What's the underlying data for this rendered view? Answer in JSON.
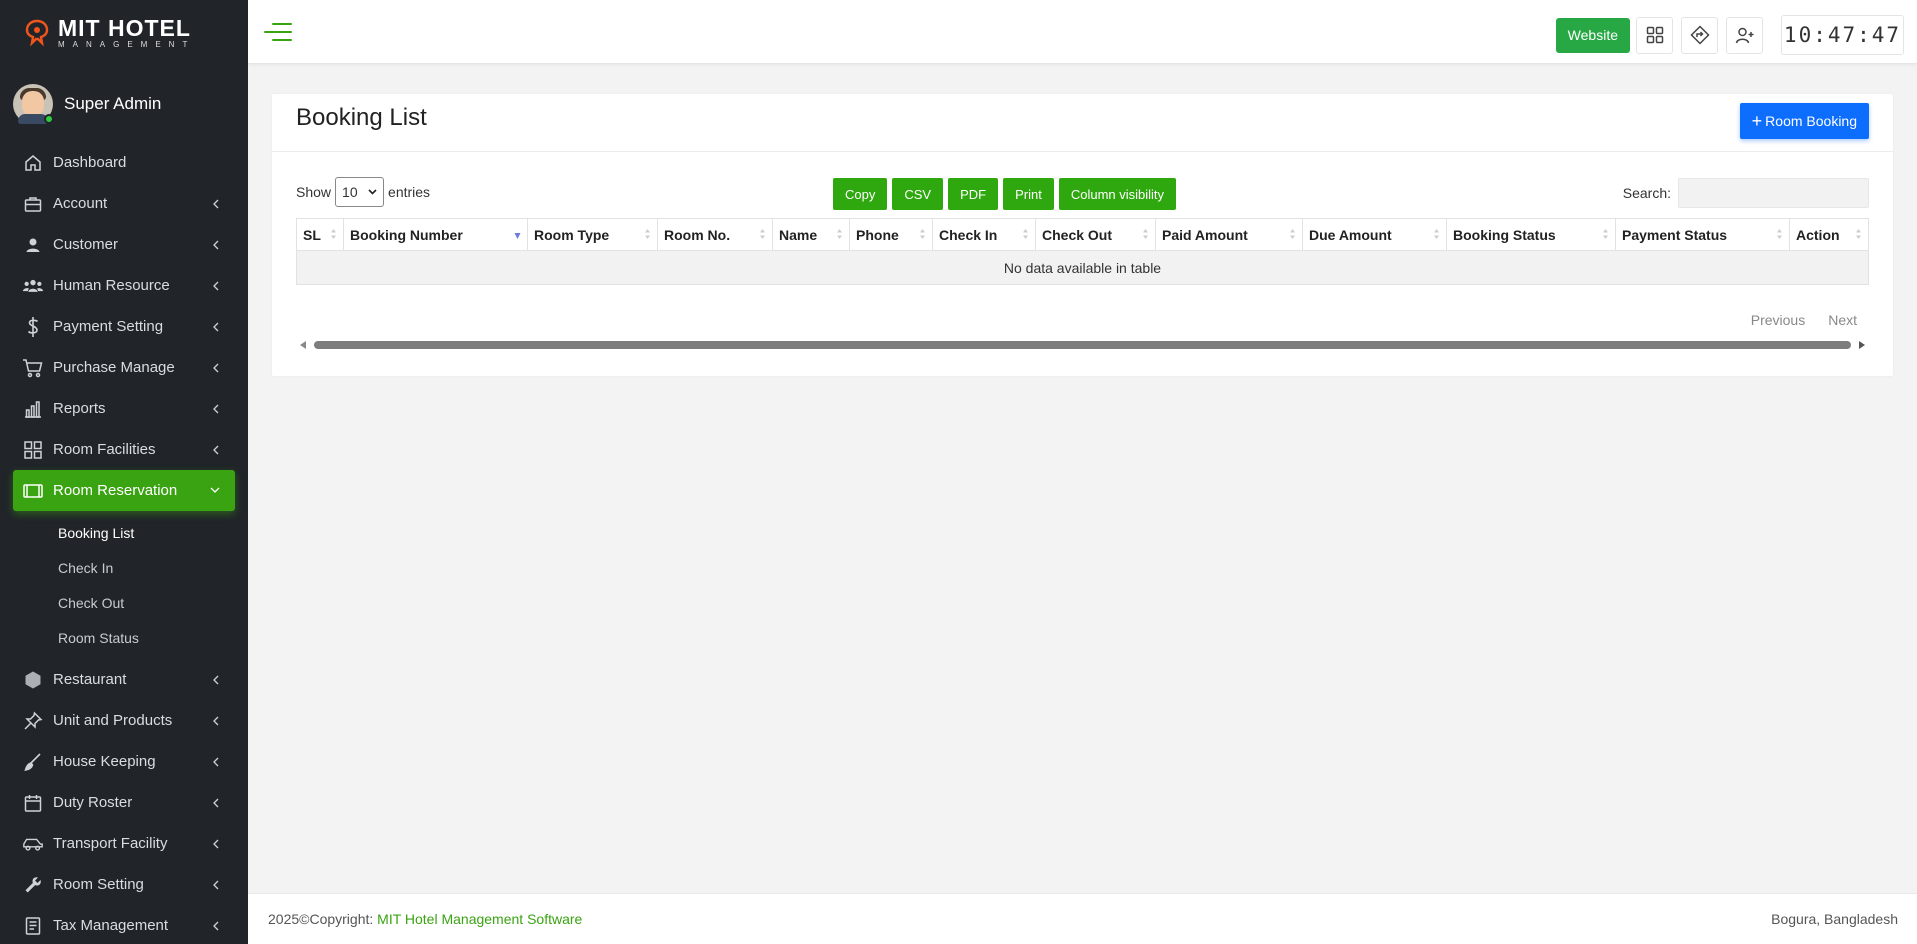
{
  "brand": {
    "title_part1": "MIT ",
    "title_part2": "HOTEL",
    "subtitle": "MANAGEMENT",
    "accent_color": "#f0561b"
  },
  "user": {
    "name": "Super Admin",
    "status": "online"
  },
  "sidebar": {
    "items": [
      {
        "label": "Dashboard",
        "icon": "home-icon",
        "has_children": false
      },
      {
        "label": "Account",
        "icon": "briefcase-icon",
        "has_children": true
      },
      {
        "label": "Customer",
        "icon": "user-icon",
        "has_children": true
      },
      {
        "label": "Human Resource",
        "icon": "users-icon",
        "has_children": true
      },
      {
        "label": "Payment Setting",
        "icon": "dollar-icon",
        "has_children": true
      },
      {
        "label": "Purchase Manage",
        "icon": "cart-icon",
        "has_children": true
      },
      {
        "label": "Reports",
        "icon": "bar-chart-icon",
        "has_children": true
      },
      {
        "label": "Room Facilities",
        "icon": "grid-icon",
        "has_children": true
      },
      {
        "label": "Room Reservation",
        "icon": "tablet-icon",
        "has_children": true,
        "active": true
      },
      {
        "label": "Restaurant",
        "icon": "hexagon-icon",
        "has_children": true
      },
      {
        "label": "Unit and Products",
        "icon": "pin-icon",
        "has_children": true
      },
      {
        "label": "House Keeping",
        "icon": "broom-icon",
        "has_children": true
      },
      {
        "label": "Duty Roster",
        "icon": "calendar-icon",
        "has_children": true
      },
      {
        "label": "Transport Facility",
        "icon": "car-icon",
        "has_children": true
      },
      {
        "label": "Room Setting",
        "icon": "wrench-icon",
        "has_children": true
      },
      {
        "label": "Tax Management",
        "icon": "receipt-icon",
        "has_children": true
      }
    ],
    "room_reservation_sub": [
      "Booking List",
      "Check In",
      "Check Out",
      "Room Status"
    ]
  },
  "topbar": {
    "website_label": "Website",
    "clock": "10:47:47"
  },
  "page": {
    "title": "Booking List",
    "add_button": "Room Booking",
    "show_label": "Show",
    "entries_value": "10",
    "entries_label": "entries",
    "export_buttons": [
      "Copy",
      "CSV",
      "PDF",
      "Print",
      "Column visibility"
    ],
    "search_label": "Search:",
    "search_value": "",
    "columns": [
      "SL",
      "Booking Number",
      "Room Type",
      "Room No.",
      "Name",
      "Phone",
      "Check In",
      "Check Out",
      "Paid Amount",
      "Due Amount",
      "Booking Status",
      "Payment Status",
      "Action"
    ],
    "empty_message": "No data available in table",
    "prev_label": "Previous",
    "next_label": "Next"
  },
  "footer": {
    "copyright": "2025©Copyright: ",
    "link": "MIT Hotel Management Software",
    "location": "Bogura, Bangladesh"
  },
  "colors": {
    "sidebar_bg": "#212529",
    "active_green": "#3aa312",
    "primary_blue": "#0d6efd",
    "website_green": "#28a745"
  }
}
